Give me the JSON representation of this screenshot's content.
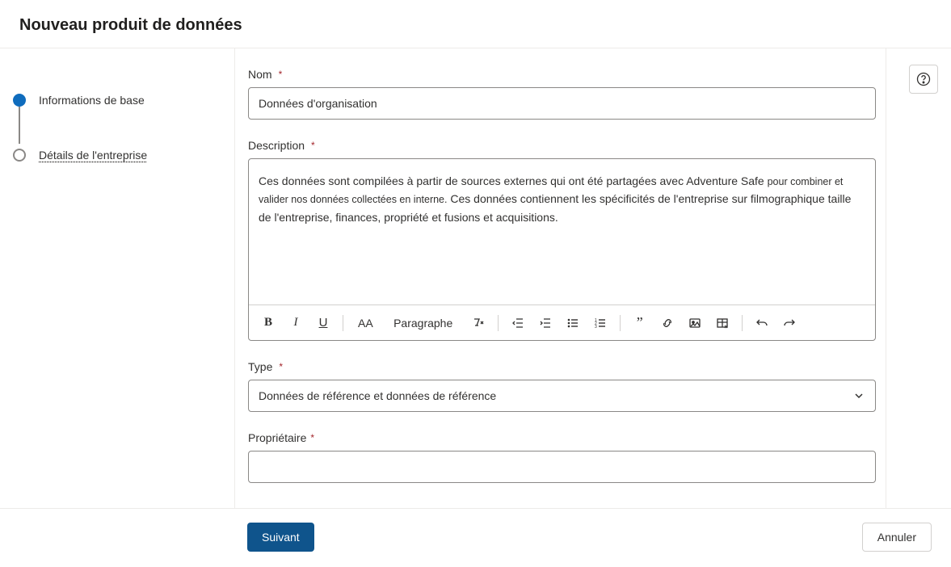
{
  "header": {
    "title": "Nouveau produit de données"
  },
  "steps": [
    {
      "label": "Informations de base",
      "active": true
    },
    {
      "label": "Détails de l'entreprise",
      "active": false
    }
  ],
  "form": {
    "name": {
      "label": "Nom",
      "required": "*",
      "value": "Données d'organisation"
    },
    "description": {
      "label": "Description",
      "required": "*",
      "value_part1": "Ces données sont compilées à partir de sources externes qui ont été partagées avec Adventure Safe ",
      "value_part2": "pour combiner et valider nos données collectées en interne.",
      "value_part3": " Ces données contiennent les spécificités de l'entreprise sur filmographique taille de l'entreprise, finances, propriété et fusions et acquisitions."
    },
    "type": {
      "label": "Type",
      "required": "*",
      "value": "Données de référence et données de référence"
    },
    "owner": {
      "label": "Propriétaire",
      "required": "*",
      "value": ""
    }
  },
  "toolbar": {
    "font_size": "AA",
    "paragraph": "Paragraphe"
  },
  "footer": {
    "next": "Suivant",
    "cancel": "Annuler"
  }
}
